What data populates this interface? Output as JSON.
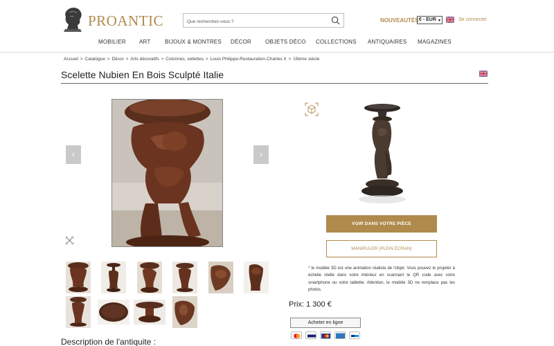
{
  "brand": {
    "name": "PROANTIC",
    "logo_icon": "bust-logo-icon",
    "accent": "#b08a4d"
  },
  "header": {
    "search_placeholder": "Que recherchez-vous ?",
    "new_label": "NOUVEAUTÉS",
    "currency": "€ - EUR",
    "login_label": "Se connecter"
  },
  "nav": [
    "MOBILIER",
    "ART",
    "BIJOUX & MONTRES",
    "DÉCOR",
    "OBJETS DÉCO",
    "COLLECTIONS",
    "ANTIQUAIRES",
    "MAGAZINES"
  ],
  "breadcrumb": [
    "Accueil",
    "Catalogue",
    "Décor",
    "Arts décoratifs",
    "Colonnes, sellettes",
    "Louis Philippe-Restauration-Charles X",
    "19ème siècle"
  ],
  "breadcrumb_sep": ">",
  "product": {
    "title": "Scelette Nubien En Bois Sculpté Italie",
    "price": "Prix: 1 300 €",
    "buy_label": "Acheter en ligne"
  },
  "gallery": {
    "dot_count": 10,
    "active_dot": 0,
    "prev_icon": "‹",
    "next_icon": "›"
  },
  "ar": {
    "view_button": "VOIR DANS VOTRE PIÈCE",
    "manipulate_button": "MANIPULER (PLEIN ÉCRAN)",
    "note": "* le modèle 3D est une animation réaliste de l'objet. Vous pouvez le projeter à échelle réelle dans votre intérieur en scannant le QR code avec votre smartphone ou votre tablette. Attention, le modèle 3D ne remplace pas les photos."
  },
  "payments": [
    "mastercard",
    "visa",
    "mastercard",
    "amex",
    "PayPal"
  ],
  "description_heading": "Description de l'antiquite :"
}
